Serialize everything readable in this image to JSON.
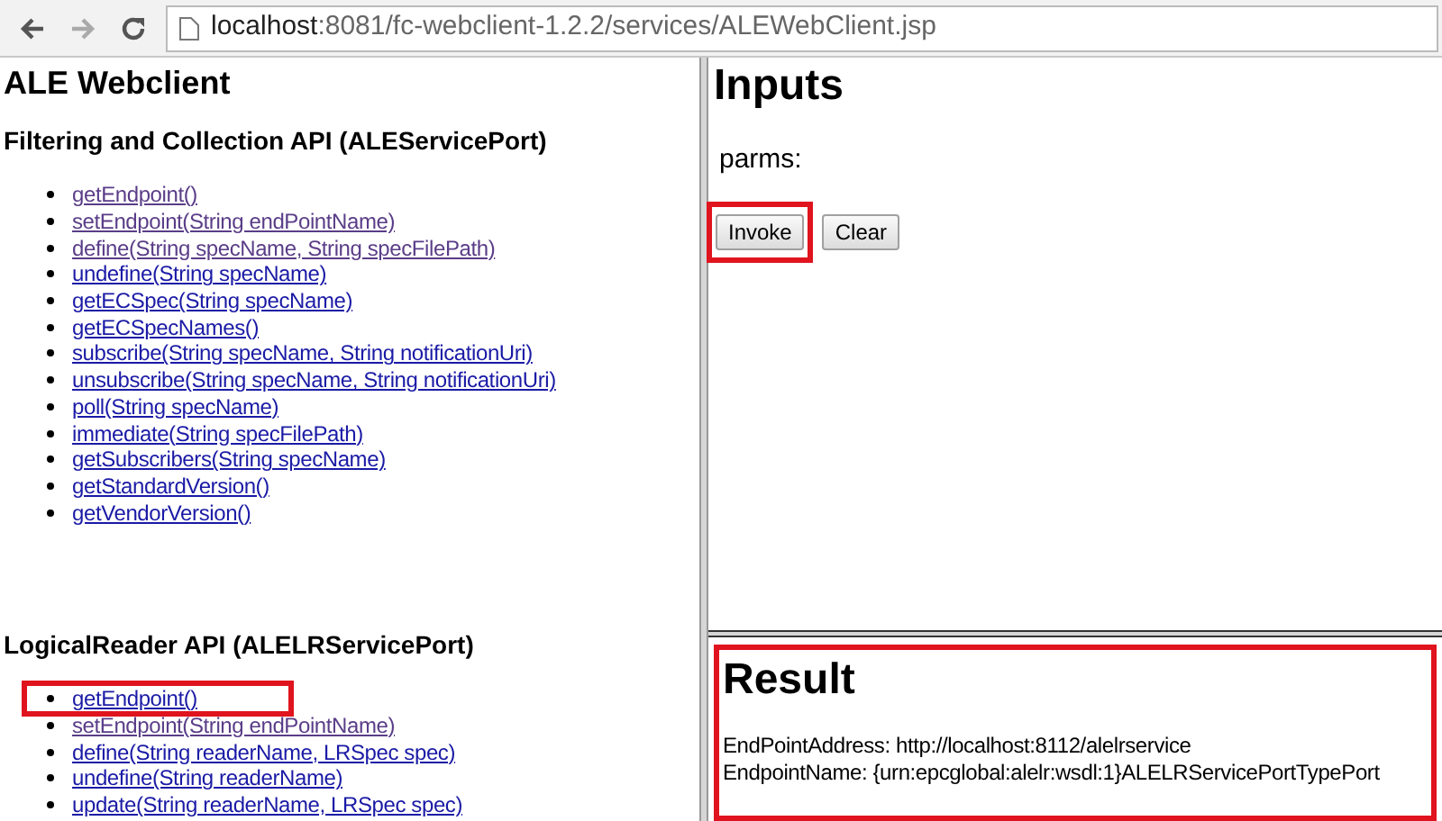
{
  "browser": {
    "url_host": "localhost",
    "url_rest": ":8081/fc-webclient-1.2.2/services/ALEWebClient.jsp"
  },
  "left_frame": {
    "title": "ALE Webclient",
    "sections": [
      {
        "heading": "Filtering and Collection API (ALEServicePort)",
        "links": [
          {
            "label": "getEndpoint()",
            "visited": true,
            "highlighted": false
          },
          {
            "label": "setEndpoint(String endPointName)",
            "visited": true,
            "highlighted": false
          },
          {
            "label": "define(String specName, String specFilePath)",
            "visited": true,
            "highlighted": false
          },
          {
            "label": "undefine(String specName)",
            "visited": false,
            "highlighted": false
          },
          {
            "label": "getECSpec(String specName)",
            "visited": false,
            "highlighted": false
          },
          {
            "label": "getECSpecNames()",
            "visited": false,
            "highlighted": false
          },
          {
            "label": "subscribe(String specName, String notificationUri)",
            "visited": false,
            "highlighted": false
          },
          {
            "label": "unsubscribe(String specName, String notificationUri)",
            "visited": false,
            "highlighted": false
          },
          {
            "label": "poll(String specName)",
            "visited": false,
            "highlighted": false
          },
          {
            "label": "immediate(String specFilePath)",
            "visited": false,
            "highlighted": false
          },
          {
            "label": "getSubscribers(String specName)",
            "visited": false,
            "highlighted": false
          },
          {
            "label": "getStandardVersion()",
            "visited": false,
            "highlighted": false
          },
          {
            "label": "getVendorVersion()",
            "visited": false,
            "highlighted": false
          }
        ]
      },
      {
        "heading": "LogicalReader API (ALELRServicePort)",
        "links": [
          {
            "label": "getEndpoint()",
            "visited": false,
            "highlighted": true
          },
          {
            "label": "setEndpoint(String endPointName)",
            "visited": true,
            "highlighted": false
          },
          {
            "label": "define(String readerName, LRSpec spec)",
            "visited": false,
            "highlighted": false
          },
          {
            "label": "undefine(String readerName)",
            "visited": false,
            "highlighted": false
          },
          {
            "label": "update(String readerName, LRSpec spec)",
            "visited": false,
            "highlighted": false
          }
        ]
      }
    ]
  },
  "inputs_frame": {
    "title": "Inputs",
    "parms_label": "parms:",
    "buttons": [
      {
        "label": "Invoke",
        "highlighted": true
      },
      {
        "label": "Clear",
        "highlighted": false
      }
    ]
  },
  "result_frame": {
    "title": "Result",
    "highlighted": true,
    "lines": [
      "EndPointAddress: http://localhost:8112/alelrservice",
      "EndpointName: {urn:epcglobal:alelr:wsdl:1}ALELRServicePortTypePort"
    ]
  }
}
